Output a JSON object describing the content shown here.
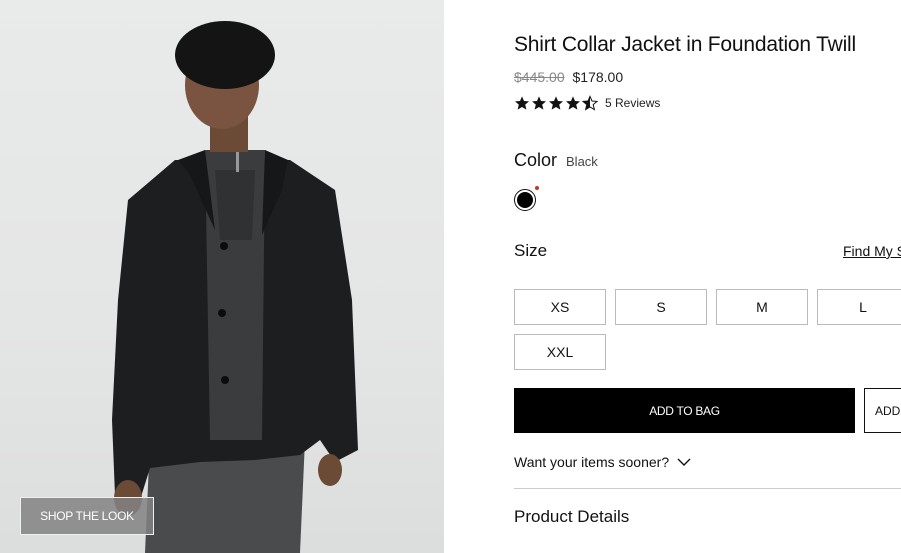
{
  "image": {
    "alt_icon": "product-photo",
    "shop_the_look_label": "SHOP THE LOOK"
  },
  "product": {
    "title": "Shirt Collar Jacket in Foundation Twill",
    "price_original": "$445.00",
    "price_sale": "$178.00",
    "rating": 4.5,
    "reviews_label": "5 Reviews"
  },
  "color": {
    "label": "Color",
    "selected": "Black",
    "swatch_hex": "#000000",
    "indicator_hex": "#c0392b"
  },
  "size": {
    "label": "Size",
    "guide_label": "Find My Size",
    "options": [
      "XS",
      "S",
      "M",
      "L",
      "XXL"
    ]
  },
  "actions": {
    "add_to_bag_label": "ADD TO BAG",
    "secondary_label": "ADD"
  },
  "shipping": {
    "sooner_label": "Want your items sooner?"
  },
  "sections": {
    "product_details_label": "Product Details"
  }
}
